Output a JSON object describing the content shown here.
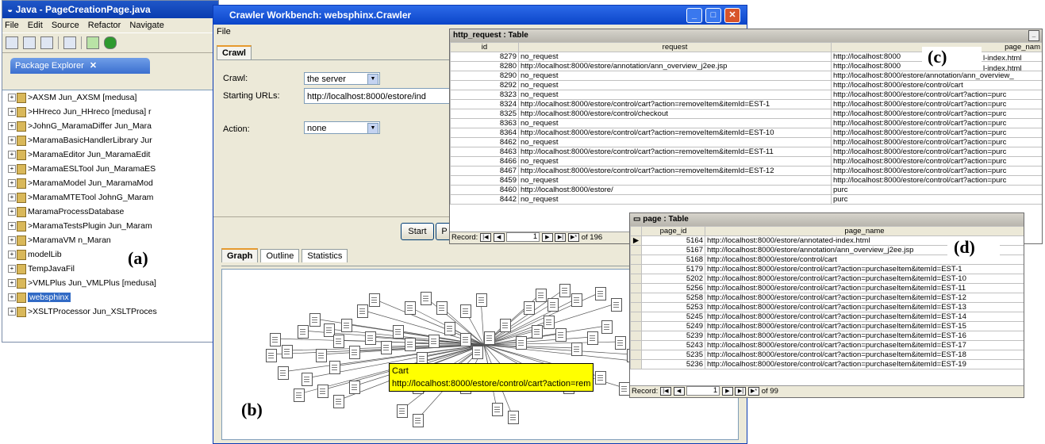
{
  "eclipse": {
    "title": "Java - PageCreationPage.java",
    "menu": [
      "File",
      "Edit",
      "Source",
      "Refactor",
      "Navigate"
    ],
    "view_tab": "Package Explorer",
    "projects": [
      ">AXSM  Jun_AXSM [medusa]",
      ">HHreco  Jun_HHreco [medusa] r",
      ">JohnG_MaramaDiffer  Jun_Mara",
      ">MaramaBasicHandlerLibrary  Jur",
      ">MaramaEditor  Jun_MaramaEdit",
      ">MaramaESLTool  Jun_MaramaES",
      ">MaramaModel  Jun_MaramaMod",
      ">MaramaMTETool  JohnG_Maram",
      "MaramaProcessDatabase",
      ">MaramaTestsPlugin  Jun_Maram",
      ">MaramaVM                n_Maran",
      "modelLib",
      "TempJavaFil",
      ">VMLPlus  Jun_VMLPlus [medusa]",
      "websphinx",
      ">XSLTProcessor  Jun_XSLTProces"
    ],
    "selected_index": 14,
    "label": "(a)"
  },
  "crawler": {
    "title": "Crawler Workbench: websphinx.Crawler",
    "menu": "File",
    "top_tab": "Crawl",
    "crawl_label": "Crawl:",
    "crawl_value": "the server",
    "starting_urls_label": "Starting URLs:",
    "starting_urls_value": "http://localhost:8000/estore/ind",
    "action_label": "Action:",
    "action_value": "none",
    "start_button": "Start",
    "pause_button": "P",
    "tabs": [
      "Graph",
      "Outline",
      "Statistics"
    ],
    "tooltip_title": "Cart",
    "tooltip_url": "http://localhost:8000/estore/control/cart?action=rem",
    "label": "(b)"
  },
  "http_request": {
    "title": "http_request : Table",
    "columns": [
      "id",
      "request",
      "page_nam"
    ],
    "rows": [
      [
        "8279",
        "no_request",
        "http://localhost:8000"
      ],
      [
        "8280",
        "http://localhost:8000/estore/annotation/ann_overview_j2ee.jsp",
        "http://localhost:8000"
      ],
      [
        "8290",
        "no_request",
        "http://localhost:8000/estore/annotation/ann_overview_"
      ],
      [
        "8292",
        "no_request",
        "http://localhost:8000/estore/control/cart"
      ],
      [
        "8323",
        "no_request",
        "http://localhost:8000/estore/control/cart?action=purc"
      ],
      [
        "8324",
        "http://localhost:8000/estore/control/cart?action=removeItem&itemId=EST-1",
        "http://localhost:8000/estore/control/cart?action=purc"
      ],
      [
        "8325",
        "http://localhost:8000/estore/control/checkout",
        "http://localhost:8000/estore/control/cart?action=purc"
      ],
      [
        "8363",
        "no_request",
        "http://localhost:8000/estore/control/cart?action=purc"
      ],
      [
        "8364",
        "http://localhost:8000/estore/control/cart?action=removeItem&itemId=EST-10",
        "http://localhost:8000/estore/control/cart?action=purc"
      ],
      [
        "8462",
        "no_request",
        "http://localhost:8000/estore/control/cart?action=purc"
      ],
      [
        "8463",
        "http://localhost:8000/estore/control/cart?action=removeItem&itemId=EST-11",
        "http://localhost:8000/estore/control/cart?action=purc"
      ],
      [
        "8466",
        "no_request",
        "http://localhost:8000/estore/control/cart?action=purc"
      ],
      [
        "8467",
        "http://localhost:8000/estore/control/cart?action=removeItem&itemId=EST-12",
        "http://localhost:8000/estore/control/cart?action=purc"
      ],
      [
        "8459",
        "no_request",
        "http://localhost:8000/estore/control/cart?action=purc"
      ],
      [
        "8460",
        "http://localhost:8000/estore/",
        "purc"
      ],
      [
        "8442",
        "no_request",
        "purc"
      ]
    ],
    "side_fragments": [
      "l-index.html",
      "l-index.html"
    ],
    "record_label": "Record:",
    "record_value": "1",
    "record_total": "of 196",
    "label": "(c)"
  },
  "page": {
    "title": "page : Table",
    "columns": [
      "page_id",
      "page_name"
    ],
    "rows": [
      [
        "5164",
        "http://localhost:8000/estore/annotated-index.html"
      ],
      [
        "5167",
        "http://localhost:8000/estore/annotation/ann_overview_j2ee.jsp"
      ],
      [
        "5168",
        "http://localhost:8000/estore/control/cart"
      ],
      [
        "5179",
        "http://localhost:8000/estore/control/cart?action=purchaseItem&itemId=EST-1"
      ],
      [
        "5202",
        "http://localhost:8000/estore/control/cart?action=purchaseItem&itemId=EST-10"
      ],
      [
        "5256",
        "http://localhost:8000/estore/control/cart?action=purchaseItem&itemId=EST-11"
      ],
      [
        "5258",
        "http://localhost:8000/estore/control/cart?action=purchaseItem&itemId=EST-12"
      ],
      [
        "5253",
        "http://localhost:8000/estore/control/cart?action=purchaseItem&itemId=EST-13"
      ],
      [
        "5245",
        "http://localhost:8000/estore/control/cart?action=purchaseItem&itemId=EST-14"
      ],
      [
        "5249",
        "http://localhost:8000/estore/control/cart?action=purchaseItem&itemId=EST-15"
      ],
      [
        "5239",
        "http://localhost:8000/estore/control/cart?action=purchaseItem&itemId=EST-16"
      ],
      [
        "5243",
        "http://localhost:8000/estore/control/cart?action=purchaseItem&itemId=EST-17"
      ],
      [
        "5235",
        "http://localhost:8000/estore/control/cart?action=purchaseItem&itemId=EST-18"
      ],
      [
        "5236",
        "http://localhost:8000/estore/control/cart?action=purchaseItem&itemId=EST-19"
      ]
    ],
    "record_label": "Record:",
    "record_value": "1",
    "record_total": "of 99",
    "label": "(d)"
  }
}
